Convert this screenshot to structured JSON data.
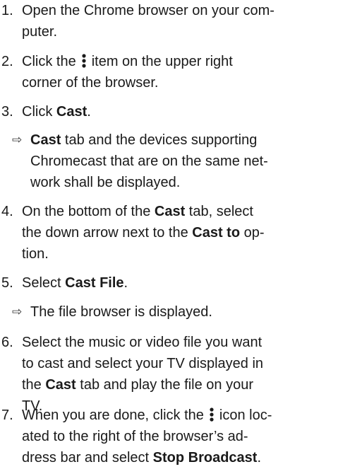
{
  "steps": [
    {
      "num": "1.",
      "l1": "Open the Chrome browser on your com-",
      "l2": "puter."
    },
    {
      "num": "2.",
      "l1_a": "Click the",
      "icon": "kebab-menu-icon",
      "l1_b": "item on the upper right",
      "l2": "corner of the browser."
    },
    {
      "num": "3.",
      "a": "Click ",
      "b": "Cast",
      "c": "."
    },
    {
      "num": "4.",
      "l1_a": "On the bottom of the ",
      "l1_b": "Cast",
      "l1_c": " tab, select",
      "l2_a": "the down arrow next to the ",
      "l2_b": "Cast to",
      "l2_c": " op-",
      "l3": "tion."
    },
    {
      "num": "5.",
      "a": "Select ",
      "b": "Cast File",
      "c": "."
    },
    {
      "num": "6.",
      "l1": "Select the music or video file you want",
      "l2": "to cast and select your TV displayed in",
      "l3_a": "the ",
      "l3_b": "Cast",
      "l3_c": " tab and play the file on your",
      "l4": "TV."
    },
    {
      "num": "7.",
      "l1_a": "When you are done, click the",
      "icon": "kebab-menu-icon",
      "l1_b": "icon loc-",
      "l2": "ated to the right of the browser’s ad-",
      "l3_a": "dress bar and select ",
      "l3_b": "Stop Broadcast",
      "l3_c": "."
    }
  ],
  "results": [
    {
      "arrow": "⇨",
      "l1_b": "Cast",
      "l1_c": " tab and the devices supporting",
      "l2": "Chromecast that are on the same net-",
      "l3": "work shall be displayed."
    },
    {
      "arrow": "⇨",
      "text": "The file browser is displayed."
    }
  ]
}
